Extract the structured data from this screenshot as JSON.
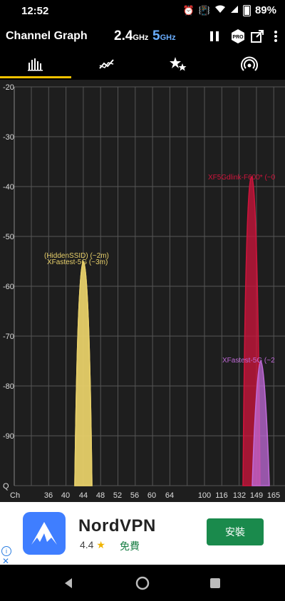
{
  "status_bar": {
    "time": "12:52",
    "battery": "89%"
  },
  "app": {
    "title": "Channel Graph",
    "band_24_value": "2.4",
    "band_24_unit": "GHz",
    "band_5_value": "5",
    "band_5_unit": "GHz",
    "pro_label": "PRO"
  },
  "tabs": [
    {
      "icon": "bar-chart-icon",
      "active": true
    },
    {
      "icon": "line-chart-icon",
      "active": false
    },
    {
      "icon": "stars-icon",
      "active": false
    },
    {
      "icon": "signal-icon",
      "active": false
    }
  ],
  "colors": {
    "accent": "#f2c200",
    "band5": "#6aaeff",
    "yellow_net": "#e8d06a",
    "red_net": "#d0143c",
    "violet_net": "#c06ad8"
  },
  "chart_data": {
    "type": "area",
    "ylabel_unit": "dBm",
    "ylim": [
      -100,
      -20
    ],
    "y_ticks": [
      "-20",
      "-30",
      "-40",
      "-50",
      "-60",
      "-70",
      "-80",
      "-90",
      "Q"
    ],
    "x_axis_label": "Ch",
    "x_ticks": [
      "36",
      "40",
      "44",
      "48",
      "52",
      "56",
      "60",
      "64",
      "100",
      "116",
      "132",
      "149",
      "165"
    ],
    "series": [
      {
        "name": "(HiddenSSID) (~2m)",
        "channel": "44",
        "level": -55
      },
      {
        "name": "XFastest-5G (~3m)",
        "channel": "44",
        "level": -55
      },
      {
        "name": "XF5Gdlink-F600* (~0",
        "channel": "149",
        "level": -38
      },
      {
        "name": "XFastest-5G (~2",
        "channel": "149",
        "level": -75
      }
    ]
  },
  "ad": {
    "name": "NordVPN",
    "rating": "4.4",
    "star": "★",
    "price": "免費",
    "install_label": "安裝",
    "info": "i",
    "close": "✕"
  },
  "nav": {
    "back": "◀",
    "home": "●",
    "recents": "■"
  }
}
